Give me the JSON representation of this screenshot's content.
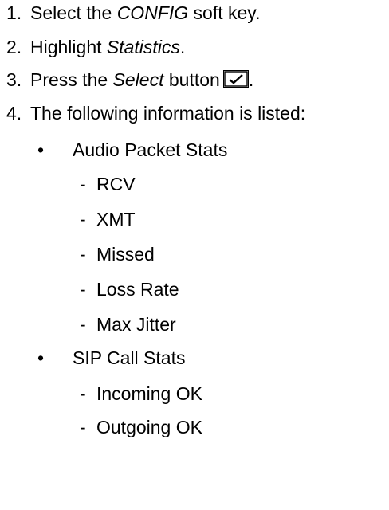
{
  "steps": [
    {
      "number": "1.",
      "pre": "Select the ",
      "em": "CONFIG",
      "post": " soft key."
    },
    {
      "number": "2.",
      "pre": "Highlight ",
      "em": "Statistics",
      "post": "."
    },
    {
      "number": "3.",
      "pre": "Press the ",
      "em": "Select",
      "post": " button",
      "after_icon": "."
    },
    {
      "number": "4.",
      "text": "The following information is listed:"
    }
  ],
  "select_icon": "checkmark-button-icon",
  "bullet_symbol": "•",
  "dash_symbol": "-",
  "groups": [
    {
      "label": "Audio Packet Stats",
      "items": [
        "RCV",
        "XMT",
        "Missed",
        "Loss Rate",
        "Max Jitter"
      ]
    },
    {
      "label": "SIP Call Stats",
      "items": [
        "Incoming OK",
        "Outgoing OK"
      ]
    }
  ]
}
